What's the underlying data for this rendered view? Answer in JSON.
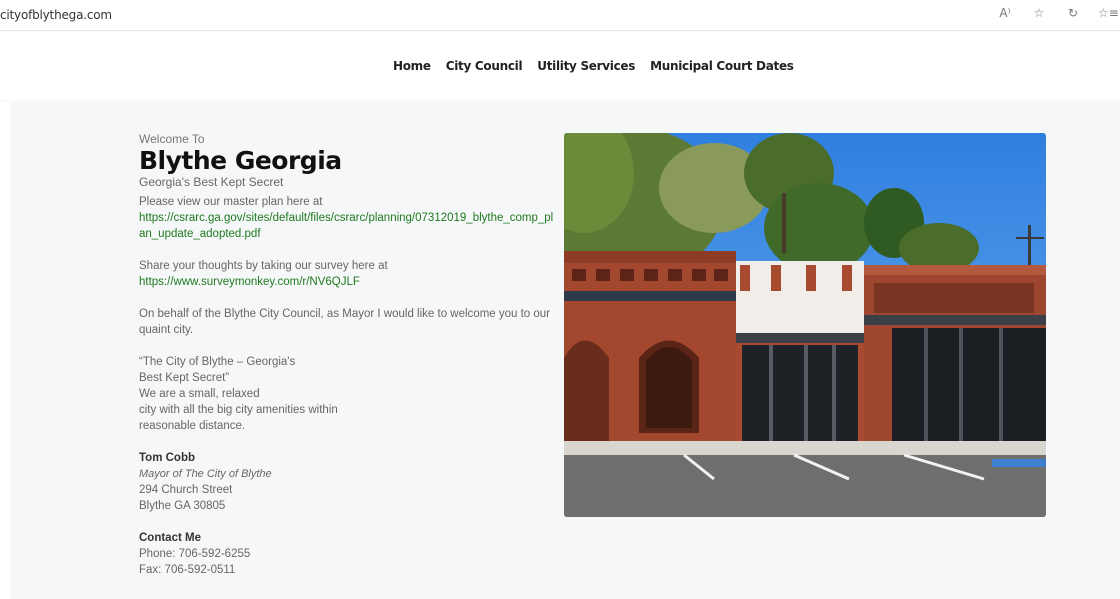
{
  "browser": {
    "url": "cityofblythega.com",
    "icons": [
      {
        "name": "read-aloud-icon",
        "glyph": "A⁾"
      },
      {
        "name": "favorite-icon",
        "glyph": "☆"
      },
      {
        "name": "refresh-icon",
        "glyph": "↻"
      },
      {
        "name": "favorites-bar-icon",
        "glyph": "☆≡"
      }
    ]
  },
  "nav": {
    "items": [
      "Home",
      "City Council",
      "Utility Services",
      "Municipal Court Dates"
    ]
  },
  "main": {
    "welcome": "Welcome To",
    "title": "Blythe Georgia",
    "tagline": "Georgia's Best Kept Secret",
    "master_plan_text": "Please view our master plan here at",
    "master_plan_link": "https://csrarc.ga.gov/sites/default/files/csrarc/planning/07312019_blythe_comp_plan_update_adopted.pdf",
    "survey_text": "Share your thoughts by taking our survey here at",
    "survey_link": "https://www.surveymonkey.com/r/NV6QJLF",
    "mayor_welcome": "On behalf of the Blythe City Council, as Mayor I would like to welcome you to our quaint city.",
    "quote_lines": [
      "“The City of Blythe – Georgia's",
      "Best Kept Secret”",
      "We are a small, relaxed",
      "city with all the big city amenities within",
      "reasonable distance."
    ],
    "mayor_name": "Tom Cobb",
    "mayor_role": "Mayor of The City of Blythe",
    "address_1": "294 Church Street",
    "address_2": "Blythe GA 30805",
    "contact_heading": "Contact Me",
    "phone": "Phone: 706-592-6255",
    "fax": "Fax: 706-592-0511"
  },
  "colors": {
    "link": "#1f7a1f",
    "background": "#f6f7f9",
    "sky": "#3f8fe6",
    "brick": "#a3472f"
  }
}
